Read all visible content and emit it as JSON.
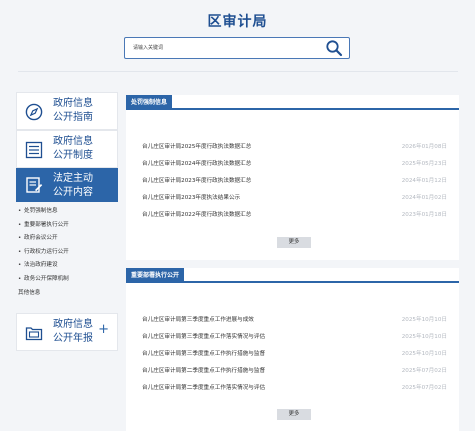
{
  "header": {
    "title": "区审计局",
    "search_placeholder": "请输入关键词"
  },
  "sidebar": {
    "cards": [
      {
        "line1": "政府信息",
        "line2": "公开指南",
        "icon": "compass-icon"
      },
      {
        "line1": "政府信息",
        "line2": "公开制度",
        "icon": "document-list-icon"
      },
      {
        "line1": "法定主动",
        "line2": "公开内容",
        "icon": "edit-document-icon",
        "active": true
      },
      {
        "line1": "政府信息",
        "line2": "公开年报",
        "icon": "folder-report-icon",
        "plus": "+"
      }
    ],
    "sub_items": [
      "处罚强制信息",
      "重要部署执行公开",
      "政府会议公开",
      "行政权力运行公开",
      "法治政府建设",
      "政务公开保障机制",
      "其他信息"
    ]
  },
  "sections": [
    {
      "tab": "处罚强制信息",
      "more": "更多",
      "rows": [
        {
          "title": "台儿庄区审计局2025年度行政执法数据汇总",
          "date": "2026年01月08日"
        },
        {
          "title": "台儿庄区审计局2024年度行政执法数据汇总",
          "date": "2025年05月23日"
        },
        {
          "title": "台儿庄区审计局2023年度行政执法数据汇总",
          "date": "2024年01月12日"
        },
        {
          "title": "台儿庄区审计局2023年度执法结果公示",
          "date": "2024年01月02日"
        },
        {
          "title": "台儿庄区审计局2022年度行政执法数据汇总",
          "date": "2023年01月18日"
        }
      ]
    },
    {
      "tab": "重要部署执行公开",
      "more": "更多",
      "rows": [
        {
          "title": "台儿庄区审计局第三季度重点工作进展与成效",
          "date": "2025年10月10日"
        },
        {
          "title": "台儿庄区审计局第三季度重点工作落实情况与评估",
          "date": "2025年10月10日"
        },
        {
          "title": "台儿庄区审计局第三季度重点工作执行措施与监督",
          "date": "2025年10月10日"
        },
        {
          "title": "台儿庄区审计局第二季度重点工作执行措施与监督",
          "date": "2025年07月02日"
        },
        {
          "title": "台儿庄区审计局第二季度重点工作落实情况与评估",
          "date": "2025年07月02日"
        }
      ]
    }
  ],
  "colors": {
    "brand_blue": "#2c65a8",
    "title_blue": "#1f4f91",
    "date_gray": "#b3b8c0",
    "page_bg": "#f3f5f8"
  }
}
